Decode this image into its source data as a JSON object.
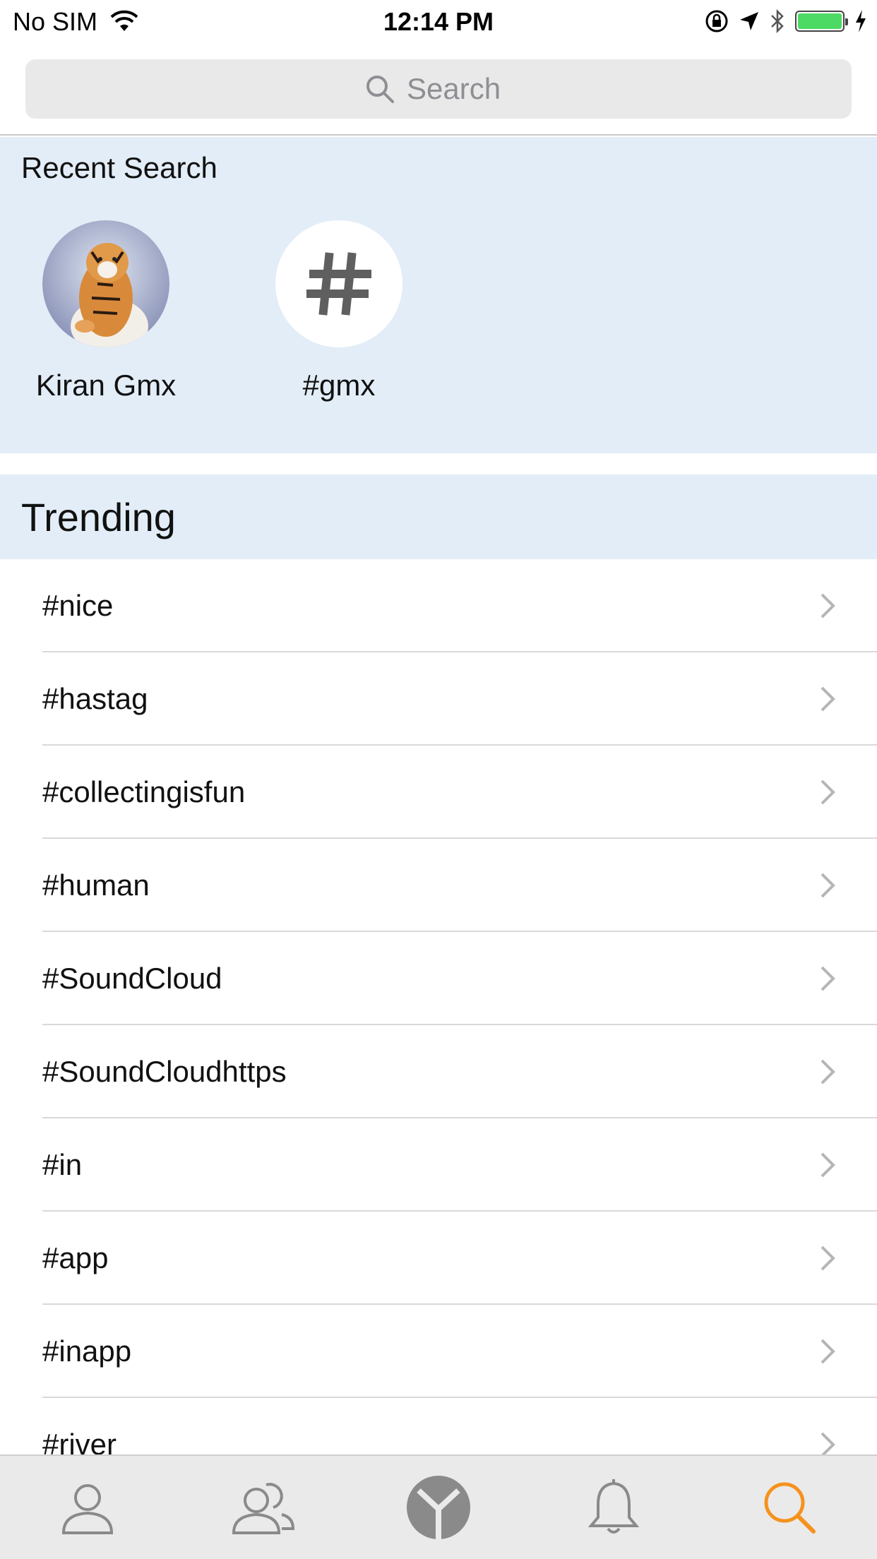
{
  "status_bar": {
    "carrier": "No SIM",
    "time": "12:14 PM",
    "battery_color": "#4cd964"
  },
  "search": {
    "placeholder": "Search"
  },
  "recent": {
    "title": "Recent Search",
    "items": [
      {
        "label": "Kiran Gmx",
        "type": "user-avatar"
      },
      {
        "label": "#gmx",
        "type": "hashtag"
      }
    ]
  },
  "trending": {
    "title": "Trending",
    "items": [
      "#nice",
      "#hastag",
      "#collectingisfun",
      "#human",
      "#SoundCloud",
      "#SoundCloudhttps",
      "#in",
      "#app",
      "#inapp",
      "#river"
    ]
  },
  "tab_bar": {
    "tabs": [
      {
        "icon": "profile-icon"
      },
      {
        "icon": "friends-icon"
      },
      {
        "icon": "home-logo-icon"
      },
      {
        "icon": "notifications-bell-icon"
      },
      {
        "icon": "search-icon",
        "active": true
      }
    ],
    "active_color": "#f5921e",
    "inactive_color": "#8a8a8a"
  }
}
